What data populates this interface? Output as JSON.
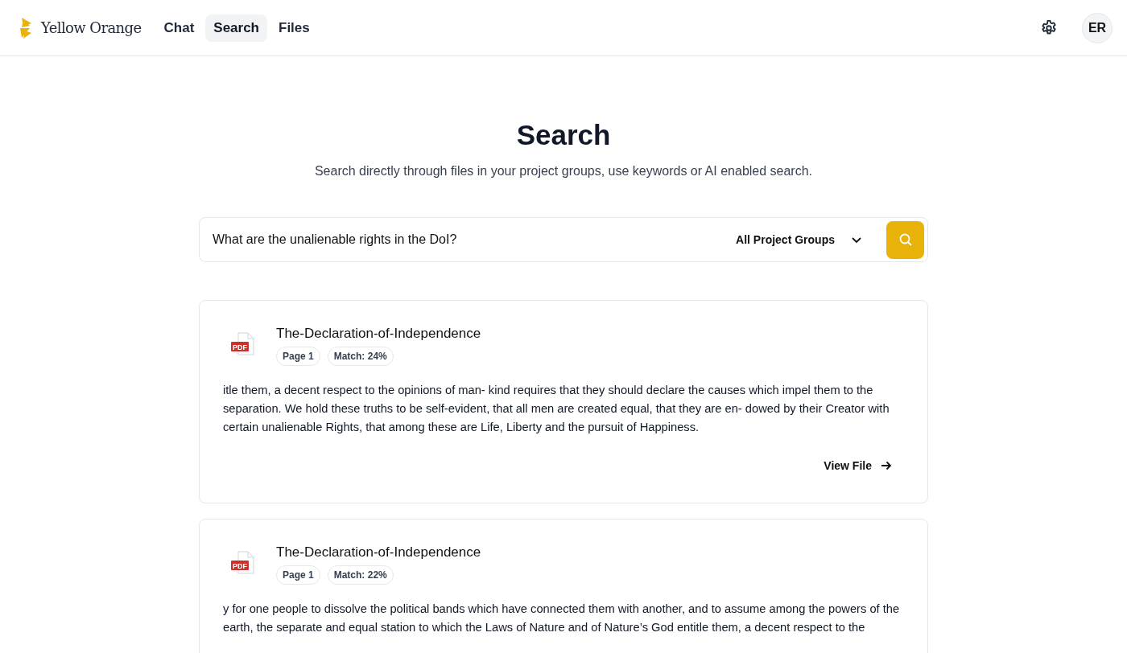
{
  "header": {
    "brand": "Yellow Orange",
    "nav": [
      {
        "label": "Chat",
        "selected": false
      },
      {
        "label": "Search",
        "selected": true
      },
      {
        "label": "Files",
        "selected": false
      }
    ],
    "avatar": "ER"
  },
  "page": {
    "title": "Search",
    "subtitle": "Search directly through files in your project groups, use keywords or AI enabled search."
  },
  "search": {
    "value": "What are the unalienable rights in the DoI?",
    "group_filter": "All Project Groups"
  },
  "results": [
    {
      "file_type": "PDF",
      "title": "The-Declaration-of-Independence",
      "page": "Page 1",
      "match": "Match: 24%",
      "excerpt": "itle them, a decent respect to the opinions of man- kind requires that they should declare the causes which impel them to the separation. We hold these truths to be self-evident, that all men are created equal, that they are en- dowed by their Creator with certain unalienable Rights, that among these are Life, Liberty and the pursuit of Happiness.",
      "action": "View File"
    },
    {
      "file_type": "PDF",
      "title": "The-Declaration-of-Independence",
      "page": "Page 1",
      "match": "Match: 22%",
      "excerpt": "y for one people to dissolve the political bands which have connected them with another, and to assume among the powers of the earth, the separate and equal station to which the Laws of Nature and of Nature’s God entitle them, a decent respect to the"
    }
  ]
}
